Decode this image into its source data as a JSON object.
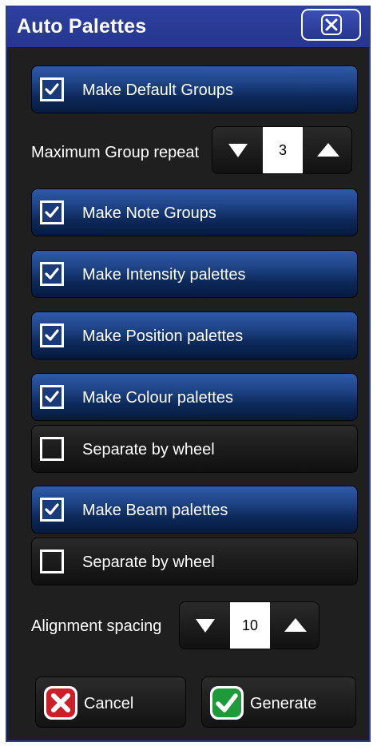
{
  "dialog": {
    "title": "Auto Palettes"
  },
  "options": [
    {
      "label": "Make Default Groups",
      "checked": true
    },
    {
      "label": "Make Note Groups",
      "checked": true
    },
    {
      "label": "Make Intensity palettes",
      "checked": true
    },
    {
      "label": "Make Position palettes",
      "checked": true
    },
    {
      "label": "Make Colour palettes",
      "checked": true
    },
    {
      "label": "Separate by wheel",
      "checked": false
    },
    {
      "label": "Make Beam palettes",
      "checked": true
    },
    {
      "label": "Separate by wheel",
      "checked": false
    }
  ],
  "group_repeat": {
    "label": "Maximum Group repeat",
    "value": "3"
  },
  "alignment": {
    "label": "Alignment spacing",
    "value": "10"
  },
  "footer": {
    "cancel_label": "Cancel",
    "generate_label": "Generate"
  },
  "colors": {
    "titlebar": "#2b3c9a",
    "checked_row": "#1f4487",
    "unchecked_row": "#1c1c1c",
    "cancel_icon": "#cc1f2a",
    "generate_icon": "#1f9a3a"
  },
  "icons": [
    "close-icon",
    "checkmark-icon",
    "arrow-down-icon",
    "arrow-up-icon",
    "cancel-x-icon",
    "generate-check-icon"
  ]
}
